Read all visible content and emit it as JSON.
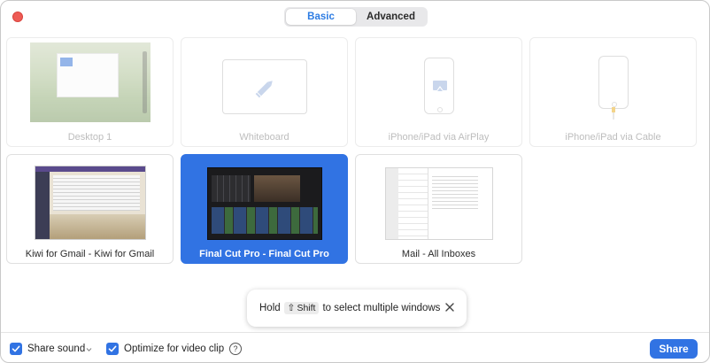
{
  "tabs": [
    {
      "label": "Basic",
      "active": true
    },
    {
      "label": "Advanced",
      "active": false
    }
  ],
  "tiles": [
    {
      "label": "Desktop 1",
      "state": "disabled"
    },
    {
      "label": "Whiteboard",
      "state": "disabled"
    },
    {
      "label": "iPhone/iPad via AirPlay",
      "state": "disabled"
    },
    {
      "label": "iPhone/iPad via Cable",
      "state": "disabled"
    },
    {
      "label": "Kiwi for Gmail - Kiwi for Gmail",
      "state": "normal"
    },
    {
      "label": "Final Cut Pro - Final Cut Pro",
      "state": "selected"
    },
    {
      "label": "Mail - All Inboxes",
      "state": "normal"
    }
  ],
  "toast": {
    "prefix": "Hold",
    "key_symbol": "⇧",
    "key_label": "Shift",
    "suffix": "to select multiple windows"
  },
  "footer": {
    "share_sound_label": "Share sound",
    "share_sound_checked": true,
    "optimize_label": "Optimize for video clip",
    "optimize_checked": true,
    "help_glyph": "?",
    "share_button_label": "Share"
  },
  "colors": {
    "accent": "#3173e3",
    "close": "#ee5b55"
  }
}
